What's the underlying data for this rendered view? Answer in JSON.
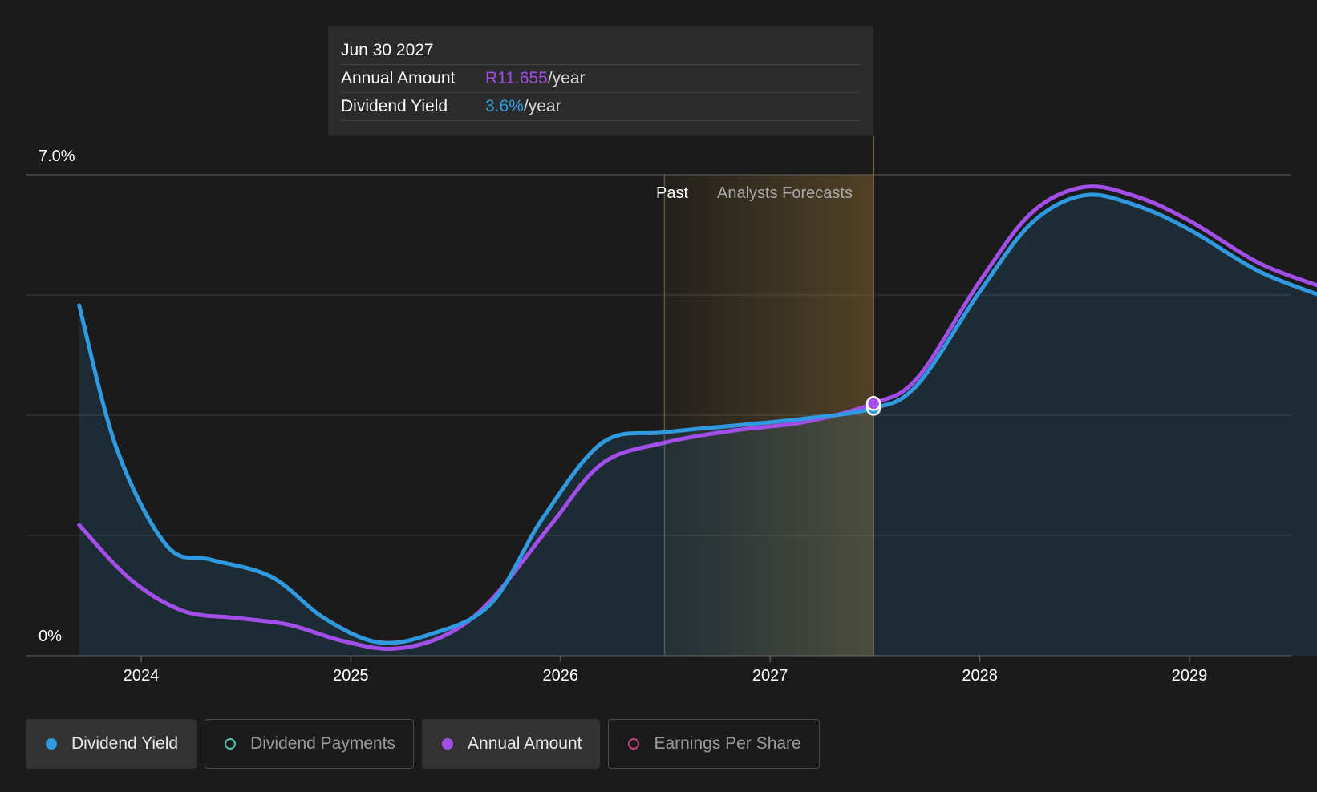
{
  "chart_data": {
    "type": "line",
    "x_ticks": [
      "2024",
      "2025",
      "2026",
      "2027",
      "2028",
      "2029"
    ],
    "y_ticks": [
      "7.0%",
      "0%"
    ],
    "ylim": [
      0,
      7.0
    ],
    "region_labels": {
      "past": "Past",
      "forecast": "Analysts Forecasts"
    },
    "series": [
      {
        "name": "Dividend Yield",
        "color": "#2f9ae0",
        "points": [
          [
            "2023-09-15",
            5.1
          ],
          [
            "2023-11-20",
            3.0
          ],
          [
            "2024-02-15",
            1.6
          ],
          [
            "2024-05-01",
            1.4
          ],
          [
            "2024-08-15",
            1.15
          ],
          [
            "2024-11-15",
            0.55
          ],
          [
            "2025-02-15",
            0.2
          ],
          [
            "2025-05-15",
            0.3
          ],
          [
            "2025-09-01",
            0.75
          ],
          [
            "2025-12-01",
            2.0
          ],
          [
            "2026-03-15",
            3.1
          ],
          [
            "2026-07-01",
            3.25
          ],
          [
            "2026-11-01",
            3.35
          ],
          [
            "2027-03-01",
            3.45
          ],
          [
            "2027-06-30",
            3.6
          ],
          [
            "2027-09-15",
            3.95
          ],
          [
            "2028-01-01",
            5.3
          ],
          [
            "2028-04-01",
            6.3
          ],
          [
            "2028-07-01",
            6.7
          ],
          [
            "2028-10-01",
            6.55
          ],
          [
            "2029-01-01",
            6.2
          ],
          [
            "2029-05-01",
            5.6
          ],
          [
            "2029-08-15",
            5.25
          ]
        ]
      },
      {
        "name": "Annual Amount",
        "color": "#a24ee8",
        "points": [
          [
            "2023-09-15",
            1.9
          ],
          [
            "2023-12-15",
            1.1
          ],
          [
            "2024-03-15",
            0.65
          ],
          [
            "2024-06-15",
            0.55
          ],
          [
            "2024-09-15",
            0.45
          ],
          [
            "2024-12-15",
            0.22
          ],
          [
            "2025-03-15",
            0.1
          ],
          [
            "2025-06-15",
            0.3
          ],
          [
            "2025-09-01",
            0.8
          ],
          [
            "2025-12-15",
            1.9
          ],
          [
            "2026-03-15",
            2.8
          ],
          [
            "2026-07-01",
            3.1
          ],
          [
            "2026-11-01",
            3.28
          ],
          [
            "2027-03-01",
            3.4
          ],
          [
            "2027-06-30",
            3.67
          ],
          [
            "2027-09-15",
            4.05
          ],
          [
            "2028-01-01",
            5.45
          ],
          [
            "2028-04-01",
            6.45
          ],
          [
            "2028-07-01",
            6.82
          ],
          [
            "2028-10-01",
            6.68
          ],
          [
            "2029-01-01",
            6.33
          ],
          [
            "2029-05-01",
            5.72
          ],
          [
            "2029-08-15",
            5.38
          ]
        ]
      }
    ],
    "tooltip": {
      "date": "Jun 30 2027",
      "rows": [
        {
          "label": "Annual Amount",
          "value": "R11.655",
          "suffix": "/year",
          "color": "#a24ee8"
        },
        {
          "label": "Dividend Yield",
          "value": "3.6%",
          "suffix": "/year",
          "color": "#2f9ae0"
        }
      ]
    },
    "past_start": "2026-07-01",
    "forecast_line": "2027-06-30"
  },
  "legend": [
    {
      "label": "Dividend Yield",
      "active": true,
      "color": "#2f9ae0",
      "filled": true
    },
    {
      "label": "Dividend Payments",
      "active": false,
      "color": "#4fc2b0",
      "filled": false
    },
    {
      "label": "Annual Amount",
      "active": true,
      "color": "#a24ee8",
      "filled": true
    },
    {
      "label": "Earnings Per Share",
      "active": false,
      "color": "#c0407a",
      "filled": false
    }
  ]
}
